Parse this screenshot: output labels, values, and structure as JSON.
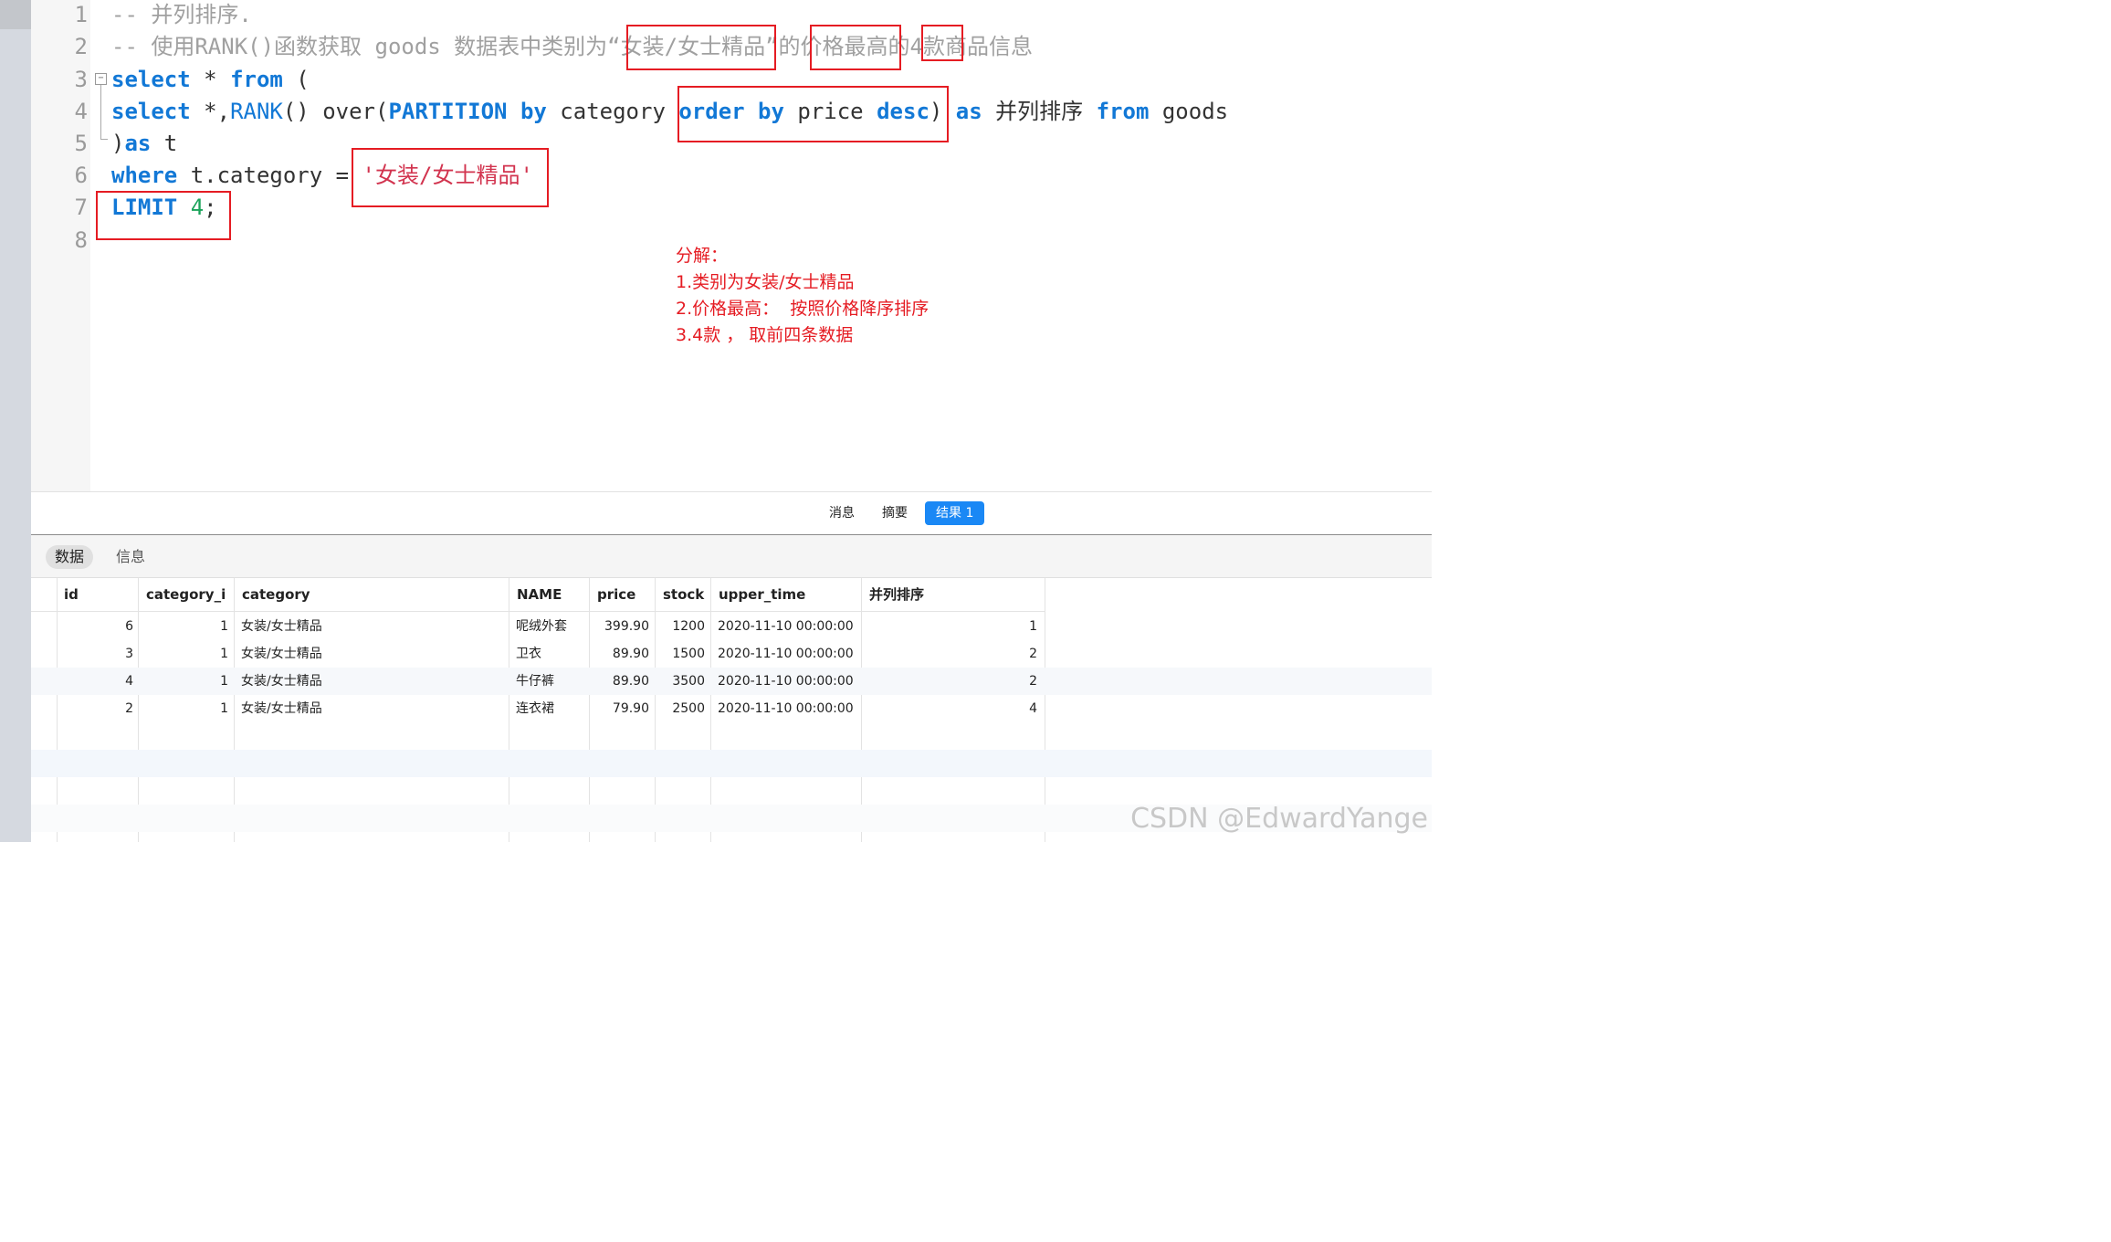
{
  "editor": {
    "line_numbers": [
      "1",
      "2",
      "3",
      "4",
      "5",
      "6",
      "7",
      "8"
    ],
    "line1": "-- 并列排序.",
    "line2": "-- 使用RANK()函数获取 goods 数据表中类别为“女装/女士精品”的价格最高的4款商品信息",
    "line3": {
      "kw_select": "select",
      "mid": " * ",
      "kw_from": "from",
      "tail": " ("
    },
    "line4": {
      "kw_select": "select",
      "part1": " *,",
      "fn_rank": "RANK",
      "part2": "() over(",
      "kw_partition": "PARTITION by",
      "part3": " category ",
      "kw_order": "order by",
      "part4": " price ",
      "kw_desc": "desc",
      "part5": ") ",
      "kw_as": "as",
      "part6": " 并列排序 ",
      "kw_from": "from",
      "part7": " goods"
    },
    "line5": {
      "part1": ")",
      "kw_as": "as",
      "part2": " t"
    },
    "line6": {
      "kw_where": "where",
      "part1": " t.category = ",
      "str": "'女装/女士精品'"
    },
    "line7": {
      "kw_limit": "LIMIT",
      "part1": " ",
      "num": "4",
      "part2": ";"
    }
  },
  "annotation": {
    "title": "分解：",
    "items": [
      "1.类别为女装/女士精品",
      "2.价格最高：  按照价格降序排序",
      "3.4款 ， 取前四条数据"
    ]
  },
  "result_tabs": [
    "消息",
    "摘要",
    "结果 1"
  ],
  "active_result_tab": "结果 1",
  "sub_tabs": [
    "数据",
    "信息"
  ],
  "active_sub_tab": "数据",
  "table": {
    "columns": [
      "id",
      "category_i",
      "category",
      "NAME",
      "price",
      "stock",
      "upper_time",
      "并列排序"
    ],
    "rows": [
      [
        "6",
        "1",
        "女装/女士精品",
        "呢绒外套",
        "399.90",
        "1200",
        "2020-11-10 00:00:00",
        "1"
      ],
      [
        "3",
        "1",
        "女装/女士精品",
        "卫衣",
        "89.90",
        "1500",
        "2020-11-10 00:00:00",
        "2"
      ],
      [
        "4",
        "1",
        "女装/女士精品",
        "牛仔裤",
        "89.90",
        "3500",
        "2020-11-10 00:00:00",
        "2"
      ],
      [
        "2",
        "1",
        "女装/女士精品",
        "连衣裙",
        "79.90",
        "2500",
        "2020-11-10 00:00:00",
        "4"
      ]
    ]
  },
  "watermark": "CSDN @EdwardYange",
  "colors": {
    "keyword": "#1278d6",
    "string": "#d2344f",
    "number": "#1aa35a",
    "comment": "#a0a0a0",
    "highlight_box": "#e51c23",
    "active_tab": "#1a88f5"
  }
}
